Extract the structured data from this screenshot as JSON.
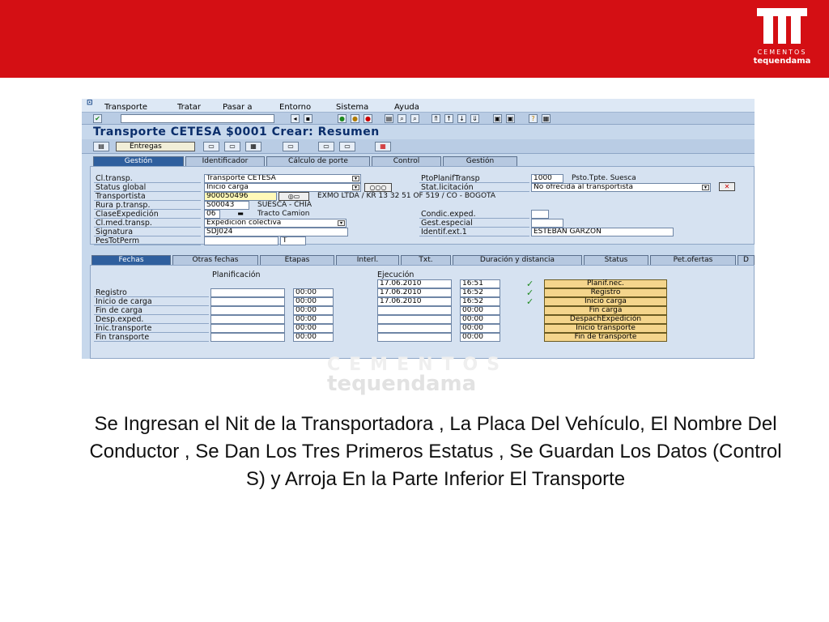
{
  "brand": {
    "logo_line1": "CEMENTOS",
    "logo_line2": "tequendama",
    "red": "#d40f14"
  },
  "sap": {
    "menu": [
      "Transporte",
      "Tratar",
      "Pasar a",
      "Entorno",
      "Sistema",
      "Ayuda"
    ],
    "title": "Transporte CETESA $0001 Crear: Resumen",
    "entregas_button": "Entregas",
    "tabs_main": [
      "Gestión",
      "Identificador",
      "Cálculo de porte",
      "Control",
      "Gestión"
    ],
    "left_fields": [
      {
        "label": "Cl.transp.",
        "value": "Transporte CETESA"
      },
      {
        "label": "Status global",
        "value": "Inicio carga"
      },
      {
        "label": "Transportista",
        "value": "900050496",
        "extra": "EXMO LTDA / KR 13 32 51 OF 519 / CO -  BOGOTA"
      },
      {
        "label": "Rura p.transp.",
        "value": "S00043",
        "extra": "SUESCA - CHIA"
      },
      {
        "label": "ClaseExpedición",
        "value": "06",
        "extra": "Tracto Camion"
      },
      {
        "label": "Cl.med.transp.",
        "value": "Expedición colectiva"
      },
      {
        "label": "Signatura",
        "value": "SDJ024"
      },
      {
        "label": "PesTotPerm",
        "value": "",
        "unit": "T"
      }
    ],
    "right_fields": [
      {
        "label": "PtoPlanifTransp",
        "value": "1000",
        "extra": "Psto.Tpte. Suesca"
      },
      {
        "label": "Stat.licitación",
        "value": "No ofrecida al transportista"
      },
      {
        "label": "Condic.exped.",
        "value": ""
      },
      {
        "label": "Gest.especial",
        "value": ""
      },
      {
        "label": "Identif.ext.1",
        "value": "ESTEBAN GARZON"
      }
    ],
    "tabs_lower": [
      "Fechas",
      "Otras fechas",
      "Etapas",
      "Interl.",
      "Txt.",
      "Duración y distancia",
      "Status",
      "Pet.ofertas",
      "D"
    ],
    "dates_header": {
      "planned": "Planificación",
      "actual": "Ejecución"
    },
    "date_rows": [
      {
        "label": "",
        "plan_date": "",
        "plan_time": "",
        "exec_date": "17.06.2010",
        "exec_time": "16:51",
        "check": true,
        "button": "Planif.nec."
      },
      {
        "label": "Registro",
        "plan_date": "",
        "plan_time": "00:00",
        "exec_date": "17.06.2010",
        "exec_time": "16:52",
        "check": true,
        "button": "Registro"
      },
      {
        "label": "Inicio de carga",
        "plan_date": "",
        "plan_time": "00:00",
        "exec_date": "17.06.2010",
        "exec_time": "16:52",
        "check": true,
        "button": "Inicio carga"
      },
      {
        "label": "Fin de carga",
        "plan_date": "",
        "plan_time": "00:00",
        "exec_date": "",
        "exec_time": "00:00",
        "check": false,
        "button": "Fin carga"
      },
      {
        "label": "Desp.exped.",
        "plan_date": "",
        "plan_time": "00:00",
        "exec_date": "",
        "exec_time": "00:00",
        "check": false,
        "button": "DespachExpedición"
      },
      {
        "label": "Inic.transporte",
        "plan_date": "",
        "plan_time": "00:00",
        "exec_date": "",
        "exec_time": "00:00",
        "check": false,
        "button": "Inicio transporte"
      },
      {
        "label": "Fin transporte",
        "plan_date": "",
        "plan_time": "00:00",
        "exec_date": "",
        "exec_time": "00:00",
        "check": false,
        "button": "Fin de transporte"
      }
    ]
  },
  "watermark": {
    "line1": "CEMENTOS",
    "line2": "tequendama"
  },
  "caption": "Se  Ingresan  el Nit de la Transportadora , La Placa Del Vehículo, El Nombre Del Conductor , Se Dan Los Tres Primeros Estatus , Se Guardan Los Datos  (Control S) y Arroja En la Parte Inferior El Transporte"
}
